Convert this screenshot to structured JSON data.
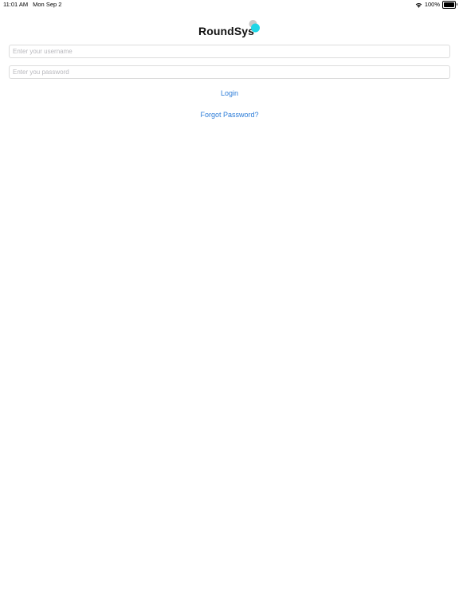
{
  "status_bar": {
    "time": "11:01 AM",
    "date": "Mon Sep 2",
    "battery_percent": "100%",
    "battery_level": 1.0
  },
  "logo": {
    "text": "RoundSys",
    "mark_colors": [
      "#c8c8c8",
      "#1fd6e6"
    ]
  },
  "login_form": {
    "username_value": "",
    "username_placeholder": "Enter your username",
    "password_value": "",
    "password_placeholder": "Enter you password",
    "login_label": "Login",
    "forgot_label": "Forgot Password?"
  },
  "colors": {
    "link": "#2a7bd8",
    "field_border": "#dcdcdc",
    "placeholder": "#b8b8bd"
  }
}
